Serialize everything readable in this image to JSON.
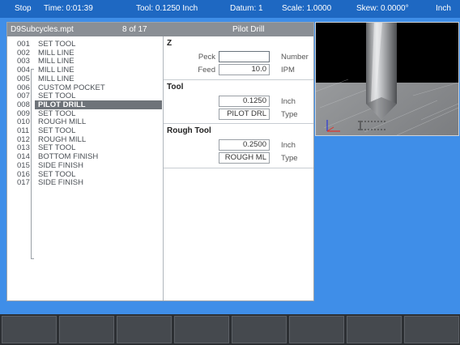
{
  "status": {
    "mode": "Stop",
    "time": "Time: 0:01:39",
    "tool": "Tool: 0.1250 Inch",
    "datum": "Datum: 1",
    "scale": "Scale: 1.0000",
    "skew": "Skew: 0.0000°",
    "units": "Inch"
  },
  "panel": {
    "filename": "D9Subcycles.mpt",
    "position": "8 of 17",
    "title": "Pilot Drill"
  },
  "steps": [
    {
      "num": "001",
      "name": "SET TOOL"
    },
    {
      "num": "002",
      "name": "MILL LINE"
    },
    {
      "num": "003",
      "name": "MILL LINE"
    },
    {
      "num": "004",
      "name": "MILL LINE"
    },
    {
      "num": "005",
      "name": "MILL LINE"
    },
    {
      "num": "006",
      "name": "CUSTOM POCKET"
    },
    {
      "num": "007",
      "name": "SET TOOL"
    },
    {
      "num": "008",
      "name": "PILOT DRILL"
    },
    {
      "num": "009",
      "name": "SET TOOL"
    },
    {
      "num": "010",
      "name": "ROUGH MILL"
    },
    {
      "num": "011",
      "name": "SET TOOL"
    },
    {
      "num": "012",
      "name": "ROUGH MILL"
    },
    {
      "num": "013",
      "name": "SET TOOL"
    },
    {
      "num": "014",
      "name": "BOTTOM FINISH"
    },
    {
      "num": "015",
      "name": "SIDE FINISH"
    },
    {
      "num": "016",
      "name": "SET TOOL"
    },
    {
      "num": "017",
      "name": "SIDE FINISH"
    }
  ],
  "selected_index": 7,
  "params": {
    "z_title": "Z",
    "peck_label": "Peck",
    "peck_value": "",
    "peck_unit": "Number",
    "feed_label": "Feed",
    "feed_value": "10.0",
    "feed_unit": "IPM",
    "tool_title": "Tool",
    "tool_dia": "0.1250",
    "tool_dia_unit": "Inch",
    "tool_type": "PILOT DRL",
    "tool_type_label": "Type",
    "rough_title": "Rough Tool",
    "rough_dia": "0.2500",
    "rough_dia_unit": "Inch",
    "rough_type": "ROUGH ML",
    "rough_type_label": "Type"
  },
  "softkeys": [
    "",
    "",
    "",
    "",
    "",
    "",
    "",
    ""
  ]
}
